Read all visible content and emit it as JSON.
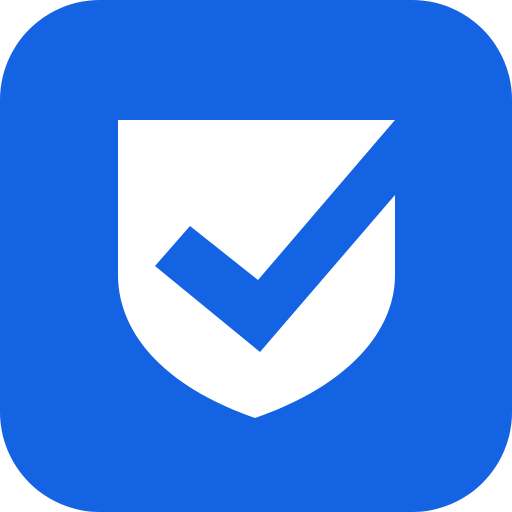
{
  "icon": {
    "name": "shield-check-icon",
    "colors": {
      "tile": "#1463E3",
      "shield": "#FFFFFF",
      "check": "#1463E3"
    }
  }
}
